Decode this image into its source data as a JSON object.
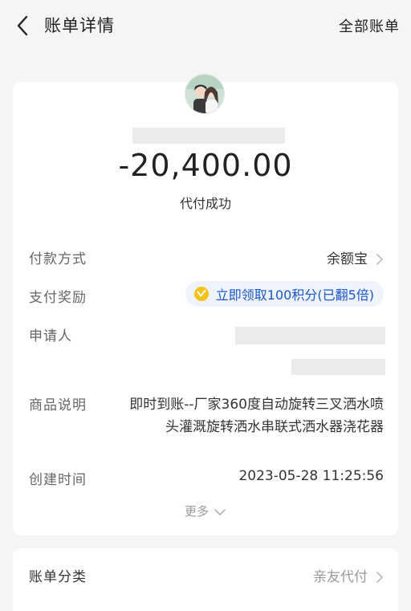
{
  "header": {
    "back_icon": "chevron-left-icon",
    "title": "账单详情",
    "right_link": "全部账单"
  },
  "summary": {
    "amount": "-20,400.00",
    "status": "代付成功"
  },
  "details": {
    "payment_method": {
      "label": "付款方式",
      "value": "余额宝"
    },
    "payment_reward": {
      "label": "支付奖励",
      "text": "立即领取100积分(已翻5倍)",
      "icon": "points-coin-icon"
    },
    "applicant": {
      "label": "申请人"
    },
    "product_desc": {
      "label": "商品说明",
      "line1": "即时到账--厂家360度自动旋转三叉洒水喷",
      "line2": "头灌溉旋转洒水串联式洒水器浇花器"
    },
    "created_time": {
      "label": "创建时间",
      "value": "2023-05-28 11:25:56"
    },
    "more": "更多"
  },
  "category": {
    "label": "账单分类",
    "value": "亲友代付"
  },
  "colors": {
    "background": "#f5f5f5",
    "card": "#ffffff",
    "accent_blue": "#1a57c8",
    "pill_background": "#eef3fc",
    "coin_yellow": "#f5c21b"
  }
}
